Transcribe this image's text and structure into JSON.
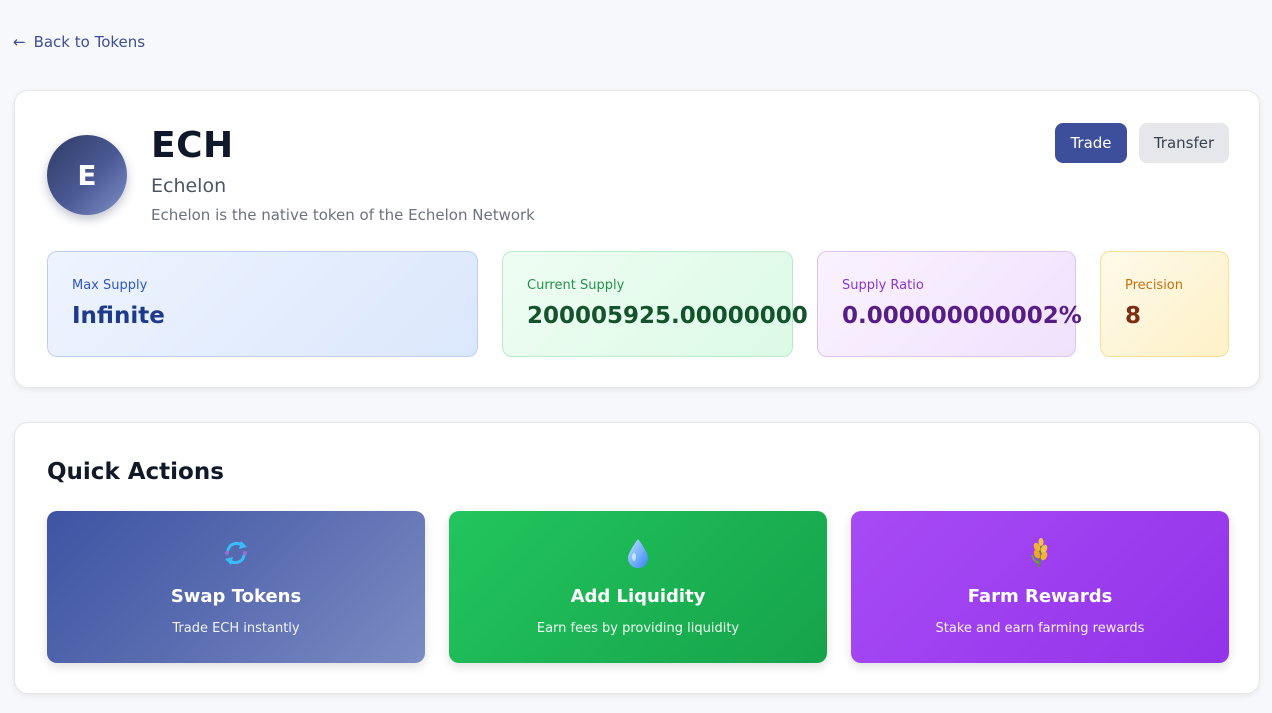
{
  "nav": {
    "back_arrow": "←",
    "back_label": "Back to Tokens"
  },
  "token": {
    "avatar_letter": "E",
    "symbol": "ECH",
    "name": "Echelon",
    "description": "Echelon is the native token of the Echelon Network"
  },
  "buttons": {
    "trade": "Trade",
    "transfer": "Transfer"
  },
  "stats": [
    {
      "label": "Max Supply",
      "value": "Infinite"
    },
    {
      "label": "Current Supply",
      "value": "200005925.00000000"
    },
    {
      "label": "Supply Ratio",
      "value": "0.000000000002%"
    },
    {
      "label": "Precision",
      "value": "8"
    }
  ],
  "quick_actions": {
    "title": "Quick Actions",
    "items": [
      {
        "icon": "swap-icon",
        "title": "Swap Tokens",
        "subtitle": "Trade ECH instantly"
      },
      {
        "icon": "droplet-icon",
        "title": "Add Liquidity",
        "subtitle": "Earn fees by providing liquidity"
      },
      {
        "icon": "wheat-icon",
        "title": "Farm Rewards",
        "subtitle": "Stake and earn farming rewards"
      }
    ]
  },
  "colors": {
    "primary": "#3d4f9a",
    "swap": "#4e63ad",
    "liquidity": "#1eb454",
    "farm": "#9d3ff0"
  }
}
